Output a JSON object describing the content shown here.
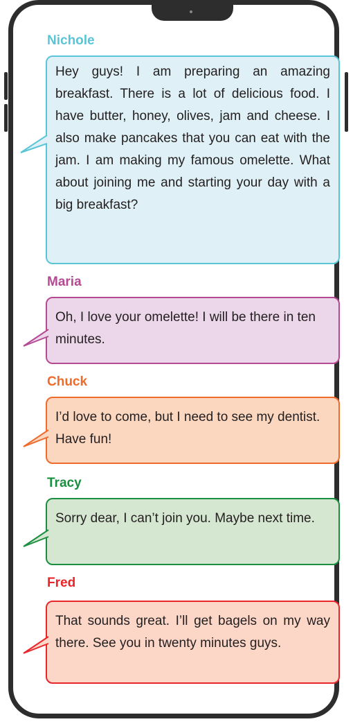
{
  "conversation": [
    {
      "sender": "Nichole",
      "message": "Hey guys! I am preparing an amazing breakfast. There is a lot of delicious food. I have butter, honey, olives, jam and cheese. I also make pancakes that you can eat with the jam. I am making my famous omelette. What about joining me and starting your day with a big breakfast?",
      "name_color": "#5bc5d8",
      "bubble_fill": "#dff1f6",
      "bubble_border": "#5bc5d8"
    },
    {
      "sender": "Maria",
      "message": "Oh, I love your omelette! I will be there in ten minutes.",
      "name_color": "#b54a93",
      "bubble_fill": "#ecd6ea",
      "bubble_border": "#b54a93"
    },
    {
      "sender": "Chuck",
      "message": "I’d love to come, but I need to see my dentist. Have fun!",
      "name_color": "#ef6b2b",
      "bubble_fill": "#fbd7c0",
      "bubble_border": "#ef6b2b"
    },
    {
      "sender": "Tracy",
      "message": "Sorry dear, I can’t join you. Maybe next time.",
      "name_color": "#1a8f3f",
      "bubble_fill": "#d5e6d1",
      "bubble_border": "#1a8f3f"
    },
    {
      "sender": "Fred",
      "message": "That sounds great. I’ll get bagels on my way there. See you in twenty minutes guys.",
      "name_color": "#e8262b",
      "bubble_fill": "#fcd6c7",
      "bubble_border": "#e8262b"
    }
  ]
}
